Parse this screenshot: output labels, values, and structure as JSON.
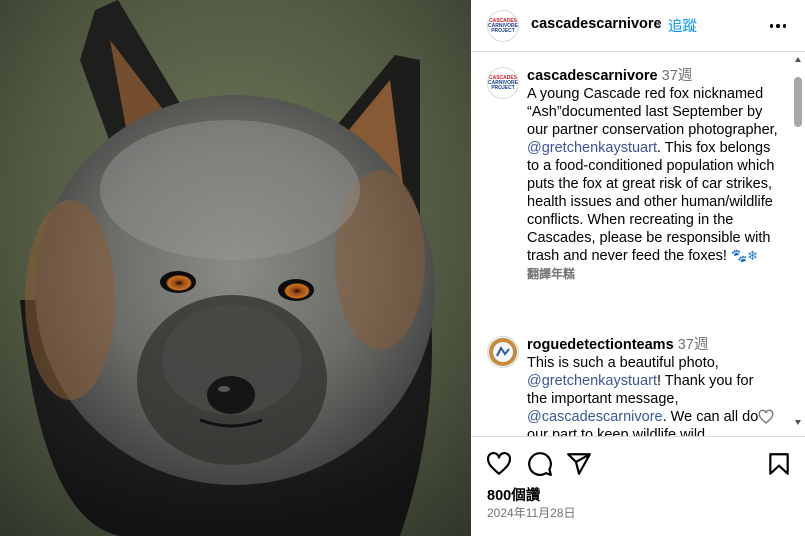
{
  "post": {
    "username": "cascadescarnivore",
    "separator": "•",
    "follow_label": "追蹤",
    "more_icon": "more-horizontal-icon",
    "photo_alt": "fox-photo"
  },
  "caption": {
    "username": "cascadescarnivore",
    "time": "37週",
    "text_part1": "A young Cascade red fox nicknamed “Ash”documented last September by our partner conservation photographer, ",
    "mention": "@gretchenkaystuart",
    "text_part2": ". This fox belongs to a food-conditioned population which puts the fox at great risk of car strikes, health issues and other human/wildlife conflicts. When recreating in the Cascades, please be responsible with trash and never feed the foxes! ",
    "emoji1": "🐾",
    "emoji2": "❄",
    "translate_label": "翻譯年糕"
  },
  "comment": {
    "username": "roguedetectionteams",
    "time": "37週",
    "text_part1": "This is such a beautiful photo, ",
    "mention1": "@gretchenkaystuart",
    "text_part2": "! Thank you for the important message, ",
    "mention2": "@cascadescarnivore",
    "text_part3": ". We can all do our part to keep wildlife wild"
  },
  "logo": {
    "line1": "CASCADES",
    "line2": "CARNIVORE",
    "line3": "PROJECT"
  },
  "footer": {
    "likes": "800個讚",
    "date": "2024年11月28日"
  },
  "colors": {
    "link": "#00376b",
    "follow": "#0095f6",
    "muted": "#737373",
    "border": "#dbdbdb"
  }
}
